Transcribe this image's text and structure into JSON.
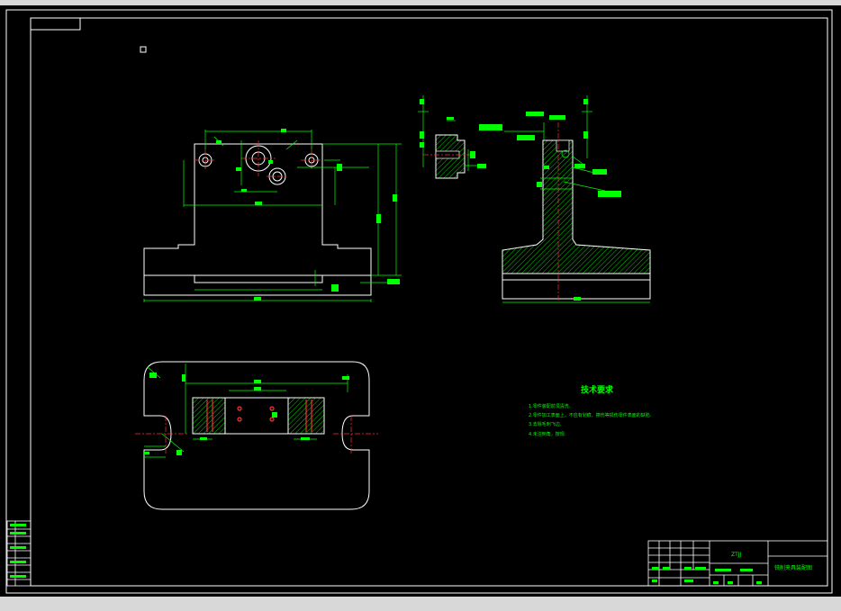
{
  "drawing": {
    "tech_title": "技术要求",
    "notes": [
      "1.零件装配前须清洗.",
      "2.零件加工表面上，不应有划痕、擦伤等损伤零件表面的缺陷.",
      "3.去除毛刺飞边.",
      "4.未注倒角，按规."
    ],
    "title_block": {
      "code": "ZTJJ",
      "name": "铣削夹具装配图"
    },
    "colors": {
      "outline": "#ffffff",
      "dimension": "#00ff00",
      "center": "#ff3030",
      "hatch": "#00ff00"
    }
  }
}
